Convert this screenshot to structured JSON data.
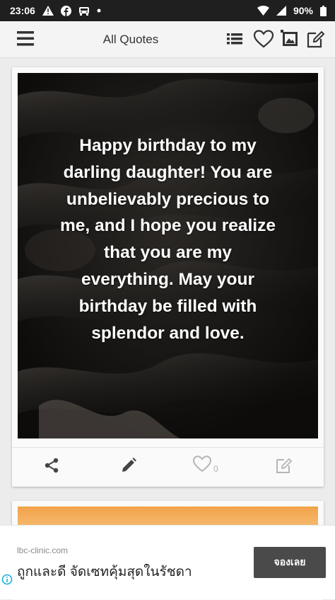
{
  "status_bar": {
    "time": "23:06",
    "battery": "90%",
    "icons": [
      "alert-icon",
      "facebook-icon",
      "car-icon",
      "dot-icon",
      "wifi-icon",
      "signal-icon",
      "battery-icon"
    ]
  },
  "app_bar": {
    "title": "All Quotes",
    "icons": [
      "menu-icon",
      "list-icon",
      "heart-icon",
      "image-icon",
      "edit-icon"
    ]
  },
  "quote_card": {
    "text": "Happy birthday to my darling daughter! You are unbelievably precious to me, and I hope you realize that you are my everything. May your birthday be filled with splendor and love.",
    "like_count": "0",
    "actions": [
      "share-icon",
      "pencil-icon",
      "heart-outline-icon",
      "edit-box-icon"
    ]
  },
  "ad": {
    "domain": "lbc-clinic.com",
    "headline": "ถูกและดี จัดเซทคุ้มสุดในรัชดา",
    "cta_label": "จองเลย"
  },
  "colors": {
    "status_bar": "#1f1f1f",
    "app_bar": "#f4f4f4",
    "quote_bg": "#1a1816",
    "ad_button": "#4a4a4a"
  }
}
